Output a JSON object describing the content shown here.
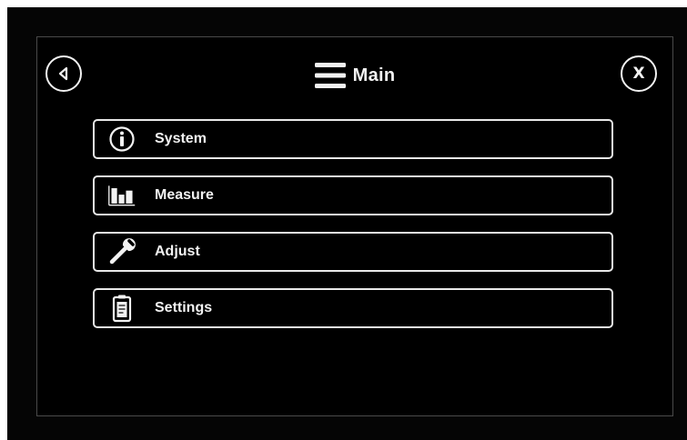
{
  "header": {
    "title": "Main",
    "title_icon": "hamburger-menu-icon",
    "back_icon": "back-arrow-icon",
    "close_label": "X"
  },
  "menu": {
    "items": [
      {
        "label": "System",
        "icon": "info-icon"
      },
      {
        "label": "Measure",
        "icon": "bar-chart-icon"
      },
      {
        "label": "Adjust",
        "icon": "wrench-icon"
      },
      {
        "label": "Settings",
        "icon": "clipboard-icon"
      }
    ]
  },
  "colors": {
    "background": "#000000",
    "foreground": "#f2f2f2",
    "panel_border": "#4a4a4a"
  }
}
